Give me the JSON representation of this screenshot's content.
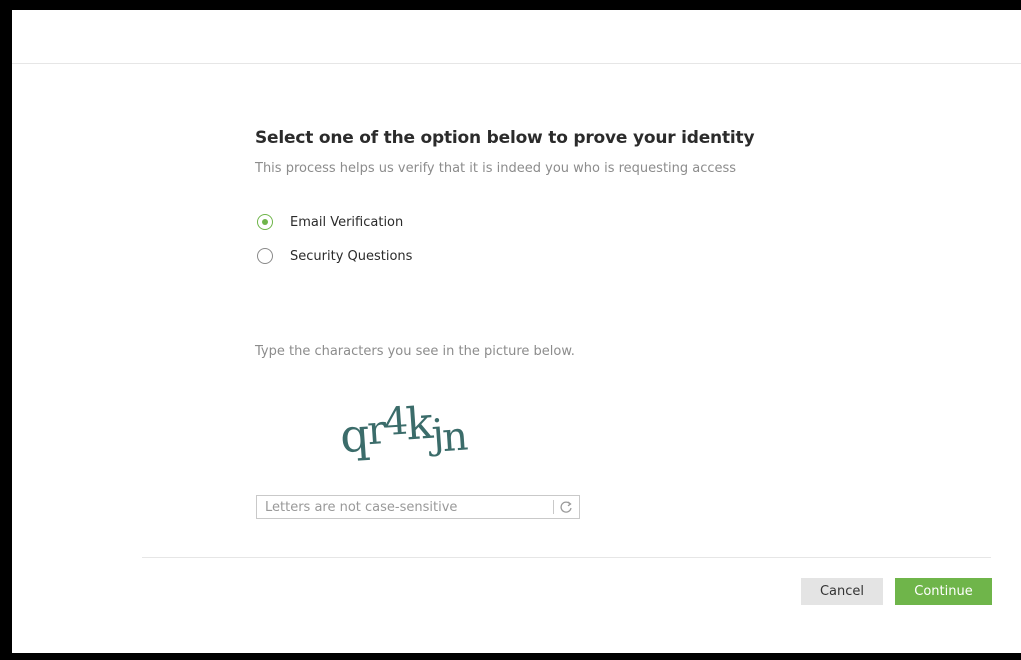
{
  "header": {
    "title": "Select one of the option below to prove your identity",
    "subtitle": "This process helps us verify that it is indeed you who is requesting access"
  },
  "options": [
    {
      "label": "Email Verification",
      "selected": true
    },
    {
      "label": "Security Questions",
      "selected": false
    }
  ],
  "captcha": {
    "prompt": "Type the characters you see in the picture below.",
    "image_text": "qr4kjn",
    "input_value": "",
    "input_placeholder": "Letters are not case-sensitive",
    "refresh_icon": "refresh-icon"
  },
  "actions": {
    "cancel_label": "Cancel",
    "continue_label": "Continue"
  },
  "colors": {
    "accent": "#6fb54a",
    "captcha_text": "#3b6c6a",
    "cancel_bg": "#e4e4e4"
  }
}
